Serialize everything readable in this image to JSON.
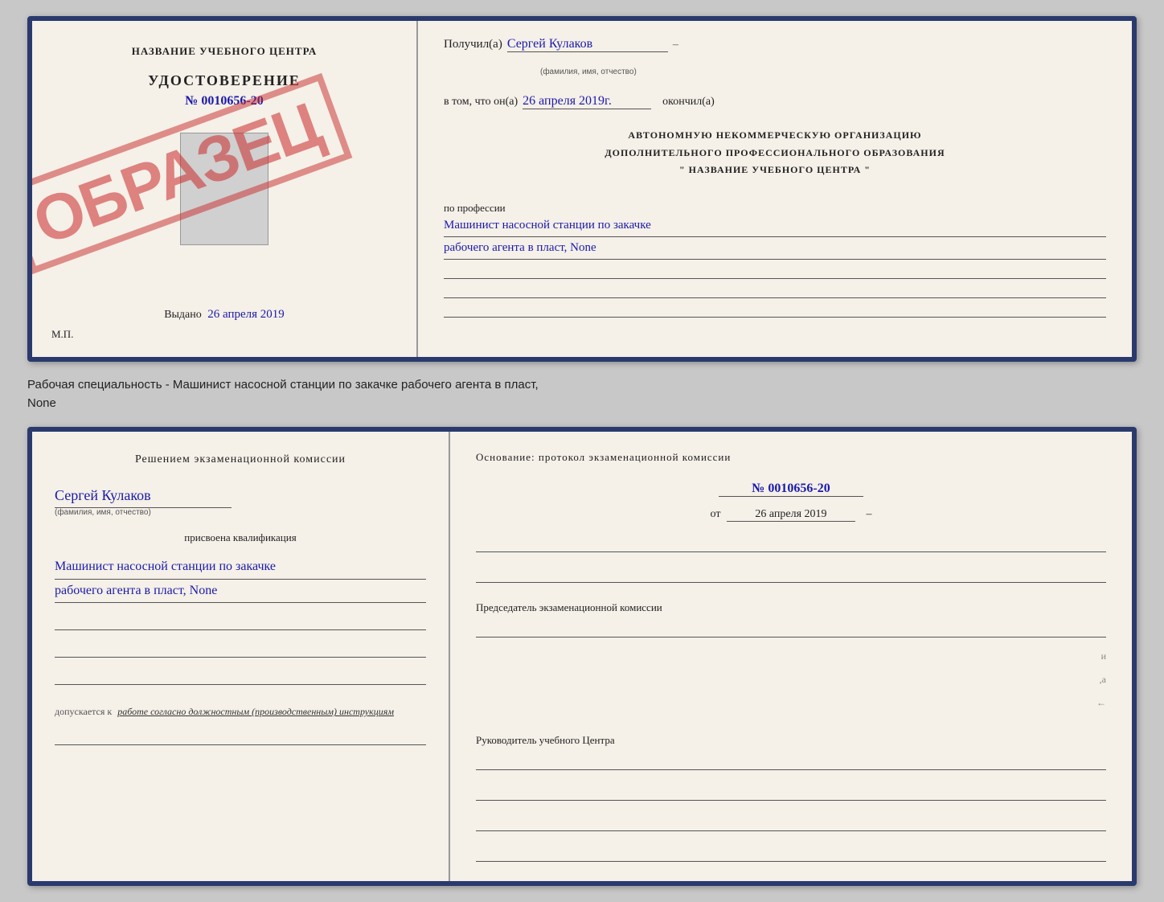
{
  "top_doc": {
    "left": {
      "center_name": "НАЗВАНИЕ УЧЕБНОГО ЦЕНТРА",
      "cert_label": "УДОСТОВЕРЕНИЕ",
      "cert_number": "№ 0010656-20",
      "issued_label": "Выдано",
      "issued_date": "26 апреля 2019",
      "mp": "М.П.",
      "stamp_text": "ОБРАЗЕЦ"
    },
    "right": {
      "received_label": "Получил(а)",
      "received_name": "Сергей Кулаков",
      "received_hint": "(фамилия, имя, отчество)",
      "in_that_label": "в том, что он(а)",
      "date_value": "26 апреля 2019г.",
      "finished_label": "окончил(а)",
      "org_line1": "АВТОНОМНУЮ НЕКОММЕРЧЕСКУЮ ОРГАНИЗАЦИЮ",
      "org_line2": "ДОПОЛНИТЕЛЬНОГО ПРОФЕССИОНАЛЬНОГО ОБРАЗОВАНИЯ",
      "org_line3": "\" НАЗВАНИЕ УЧЕБНОГО ЦЕНТРА \"",
      "profession_label": "по профессии",
      "profession_line1": "Машинист насосной станции по закачке",
      "profession_line2": "рабочего агента в пласт, None"
    }
  },
  "between_text": {
    "line1": "Рабочая специальность - Машинист насосной станции по закачке рабочего агента в пласт,",
    "line2": "None"
  },
  "bottom_doc": {
    "left": {
      "decision_text": "Решением экзаменационной комиссии",
      "name_value": "Сергей Кулаков",
      "name_hint": "(фамилия, имя, отчество)",
      "assigned_label": "присвоена квалификация",
      "qual_line1": "Машинист насосной станции по закачке",
      "qual_line2": "рабочего агента в пласт, None",
      "допускается_prefix": "допускается к",
      "допускается_text": "работе согласно должностным (производственным) инструкциям"
    },
    "right": {
      "basis_label": "Основание: протокол экзаменационной комиссии",
      "protocol_number": "№ 0010656-20",
      "date_prefix": "от",
      "date_value": "26 апреля 2019",
      "chairman_label": "Председатель экзаменационной комиссии",
      "director_label": "Руководитель учебного Центра"
    }
  }
}
